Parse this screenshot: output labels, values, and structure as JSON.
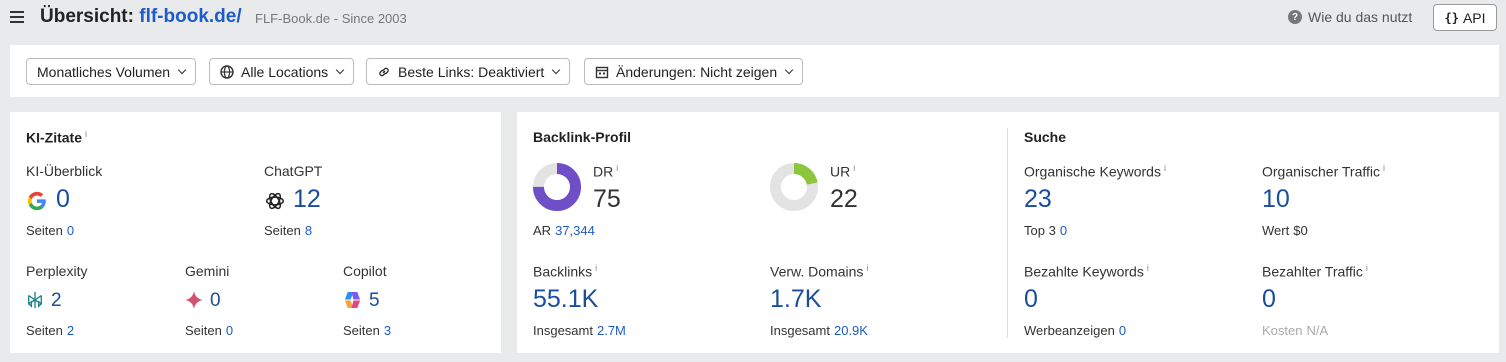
{
  "header": {
    "title_prefix": "Übersicht:",
    "domain": "flf-book.de/",
    "subtitle": "FLF-Book.de - Since 2003",
    "help_label": "Wie du das nutzt",
    "api_label": "API",
    "api_icon": "{}"
  },
  "filters": {
    "volume": "Monatliches Volumen",
    "locations": "Alle Locations",
    "best_links": "Beste Links: Deaktiviert",
    "changes": "Änderungen: Nicht zeigen"
  },
  "ai_citations": {
    "title": "KI-Zitate",
    "ai_overview": {
      "label": "KI-Überblick",
      "value": "0",
      "sub_label": "Seiten",
      "sub_value": "0"
    },
    "chatgpt": {
      "label": "ChatGPT",
      "value": "12",
      "sub_label": "Seiten",
      "sub_value": "8"
    },
    "perplexity": {
      "label": "Perplexity",
      "value": "2",
      "sub_label": "Seiten",
      "sub_value": "2"
    },
    "gemini": {
      "label": "Gemini",
      "value": "0",
      "sub_label": "Seiten",
      "sub_value": "0"
    },
    "copilot": {
      "label": "Copilot",
      "value": "5",
      "sub_label": "Seiten",
      "sub_value": "3"
    }
  },
  "backlinks": {
    "title": "Backlink-Profil",
    "dr": {
      "label": "DR",
      "value": "75",
      "sub_label": "AR",
      "sub_value": "37,344",
      "gauge": 75,
      "color": "#6f4fc7"
    },
    "ur": {
      "label": "UR",
      "value": "22",
      "gauge": 22,
      "color": "#8cc63f"
    },
    "backlinks": {
      "label": "Backlinks",
      "value": "55.1K",
      "sub_label": "Insgesamt",
      "sub_value": "2.7M"
    },
    "ref_domains": {
      "label": "Verw. Domains",
      "value": "1.7K",
      "sub_label": "Insgesamt",
      "sub_value": "20.9K"
    }
  },
  "search": {
    "title": "Suche",
    "organic_keywords": {
      "label": "Organische Keywords",
      "value": "23",
      "sub_label": "Top 3",
      "sub_value": "0"
    },
    "organic_traffic": {
      "label": "Organischer Traffic",
      "value": "10",
      "sub_label": "Wert",
      "sub_value": "$0"
    },
    "paid_keywords": {
      "label": "Bezahlte Keywords",
      "value": "0",
      "sub_label": "Werbeanzeigen",
      "sub_value": "0"
    },
    "paid_traffic": {
      "label": "Bezahlter Traffic",
      "value": "0",
      "sub_label": "Kosten",
      "sub_value": "N/A"
    }
  }
}
